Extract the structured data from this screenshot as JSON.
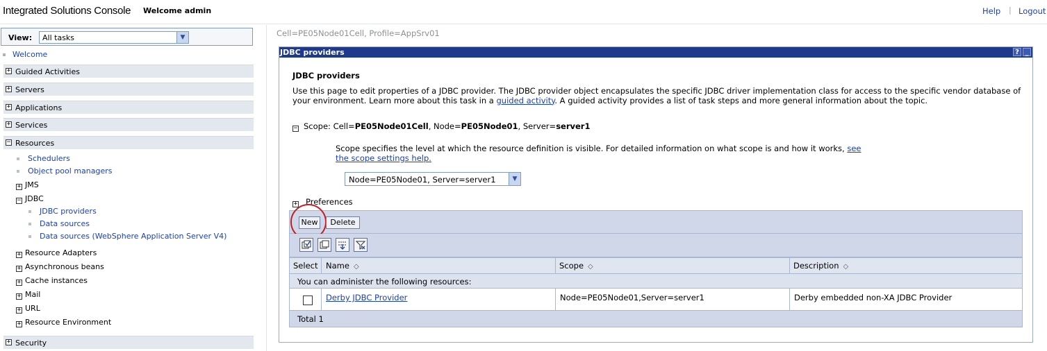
{
  "header": {
    "app_title": "Integrated Solutions Console",
    "welcome": "Welcome admin",
    "help": "Help",
    "separator": "|",
    "logout": "Logout"
  },
  "nav": {
    "view_label": "View:",
    "view_value": "All tasks",
    "welcome": "Welcome",
    "sections": {
      "guided": "Guided Activities",
      "servers": "Servers",
      "applications": "Applications",
      "services": "Services",
      "resources": "Resources",
      "security": "Security"
    },
    "resources": {
      "schedulers": "Schedulers",
      "object_pool": "Object pool managers",
      "jms": "JMS",
      "jdbc": "JDBC",
      "jdbc_providers": "JDBC providers",
      "data_sources": "Data sources",
      "data_sources_v4": "Data sources (WebSphere Application Server V4)",
      "resource_adapters": "Resource Adapters",
      "async_beans": "Asynchronous beans",
      "cache": "Cache instances",
      "mail": "Mail",
      "url": "URL",
      "resource_env": "Resource Environment"
    }
  },
  "content": {
    "breadcrumb": "Cell=PE05Node01Cell, Profile=AppSrv01",
    "portlet_title": "JDBC providers",
    "help_btn": "?",
    "min_btn": "_",
    "page_heading": "JDBC providers",
    "desc_part1": "Use this page to edit properties of a JDBC provider. The JDBC provider object encapsulates the specific JDBC driver implementation class for access to the specific vendor database of your environment. Learn more about this task in a ",
    "desc_link": "guided activity",
    "desc_part2": ". A guided activity provides a list of task steps and more general information about the topic.",
    "scope_prefix": "Scope: Cell=",
    "scope_cell": "PE05Node01Cell",
    "scope_node_prefix": ", Node=",
    "scope_node": "PE05Node01",
    "scope_server_prefix": ", Server=",
    "scope_server": "server1",
    "scope_help": "Scope specifies the level at which the resource definition is visible. For detailed information on what scope is and how it works, ",
    "scope_help_link": "see the scope settings help.",
    "scope_select_value": "Node=PE05Node01, Server=server1",
    "preferences": "Preferences",
    "new_button": "New",
    "delete_button": "Delete",
    "columns": {
      "select": "Select",
      "name": "Name",
      "scope": "Scope",
      "description": "Description"
    },
    "group_text": "You can administer the following resources:",
    "row": {
      "name": "Derby JDBC Provider",
      "scope": "Node=PE05Node01,Server=server1",
      "description": "Derby embedded non-XA JDBC Provider"
    },
    "total": "Total 1"
  },
  "colors": {
    "titlebar": "#1f3a8c",
    "link": "#1a3fbf",
    "highlight_circle": "#c01f24"
  }
}
